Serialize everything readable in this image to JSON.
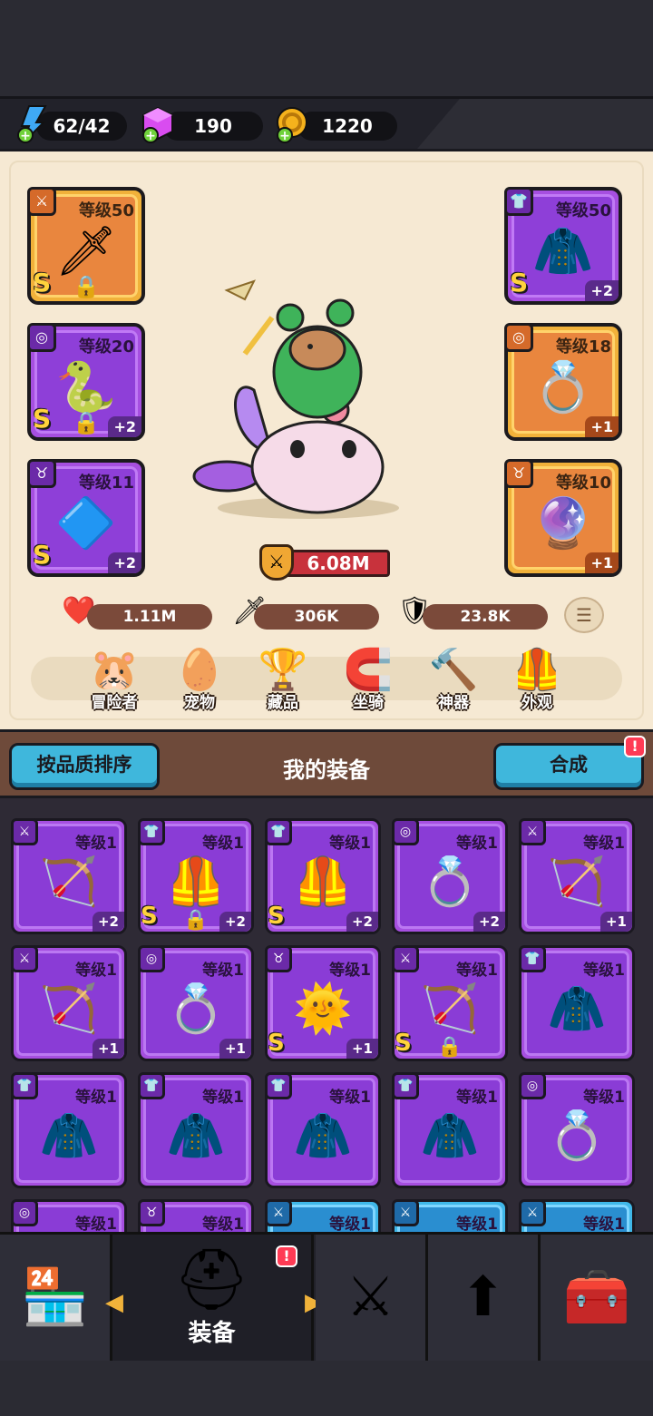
{
  "resources": {
    "energy": {
      "value": "62/42",
      "icon": "lightning-plus-icon"
    },
    "gems": {
      "value": "190",
      "icon": "gem-plus-icon"
    },
    "gold": {
      "value": "1220",
      "icon": "coin-plus-icon"
    }
  },
  "equipped": [
    {
      "id": "weapon",
      "level": "等级50",
      "rank": "S",
      "plus": "",
      "locked": true,
      "quality": "orange"
    },
    {
      "id": "ring",
      "level": "等级20",
      "rank": "S",
      "plus": "+2",
      "locked": true,
      "quality": "purple"
    },
    {
      "id": "amulet",
      "level": "等级11",
      "rank": "S",
      "plus": "+2",
      "locked": false,
      "quality": "purple"
    },
    {
      "id": "armor",
      "level": "等级50",
      "rank": "S",
      "plus": "+2",
      "locked": false,
      "quality": "purple"
    },
    {
      "id": "ring2",
      "level": "等级18",
      "rank": "",
      "plus": "+1",
      "locked": false,
      "quality": "orange"
    },
    {
      "id": "amulet2",
      "level": "等级10",
      "rank": "",
      "plus": "+1",
      "locked": false,
      "quality": "orange"
    }
  ],
  "power": "6.08M",
  "stats": {
    "hp": "1.11M",
    "attack": "306K",
    "defense": "23.8K"
  },
  "tabs": [
    "冒险者",
    "宠物",
    "藏品",
    "坐骑",
    "神器",
    "外观"
  ],
  "inventory_header": {
    "sort_label": "按品质排序",
    "title": "我的装备",
    "merge_label": "合成",
    "merge_badge": "!"
  },
  "inventory": [
    {
      "level": "等级1",
      "rank": "",
      "plus": "+2",
      "locked": false
    },
    {
      "level": "等级1",
      "rank": "S",
      "plus": "+2",
      "locked": true
    },
    {
      "level": "等级1",
      "rank": "S",
      "plus": "+2",
      "locked": false
    },
    {
      "level": "等级1",
      "rank": "",
      "plus": "+2",
      "locked": false
    },
    {
      "level": "等级1",
      "rank": "",
      "plus": "+1",
      "locked": false
    },
    {
      "level": "等级1",
      "rank": "",
      "plus": "+1",
      "locked": false
    },
    {
      "level": "等级1",
      "rank": "",
      "plus": "+1",
      "locked": false
    },
    {
      "level": "等级1",
      "rank": "S",
      "plus": "+1",
      "locked": false
    },
    {
      "level": "等级1",
      "rank": "S",
      "plus": "",
      "locked": true
    },
    {
      "level": "等级1",
      "rank": "",
      "plus": "",
      "locked": false
    },
    {
      "level": "等级1",
      "rank": "",
      "plus": "",
      "locked": false
    },
    {
      "level": "等级1",
      "rank": "",
      "plus": "",
      "locked": false
    },
    {
      "level": "等级1",
      "rank": "",
      "plus": "",
      "locked": false
    },
    {
      "level": "等级1",
      "rank": "",
      "plus": "",
      "locked": false
    },
    {
      "level": "等级1",
      "rank": "",
      "plus": "",
      "locked": false
    },
    {
      "level": "等级1",
      "rank": "",
      "plus": "",
      "locked": false
    },
    {
      "level": "等级1",
      "rank": "",
      "plus": "",
      "locked": false
    },
    {
      "level": "等级1",
      "rank": "",
      "plus": "",
      "locked": false
    },
    {
      "level": "等级1",
      "rank": "",
      "plus": "",
      "locked": false
    },
    {
      "level": "等级1",
      "rank": "",
      "plus": "",
      "locked": false
    }
  ],
  "bottom_nav": {
    "active_label": "装备",
    "badge": "!"
  }
}
